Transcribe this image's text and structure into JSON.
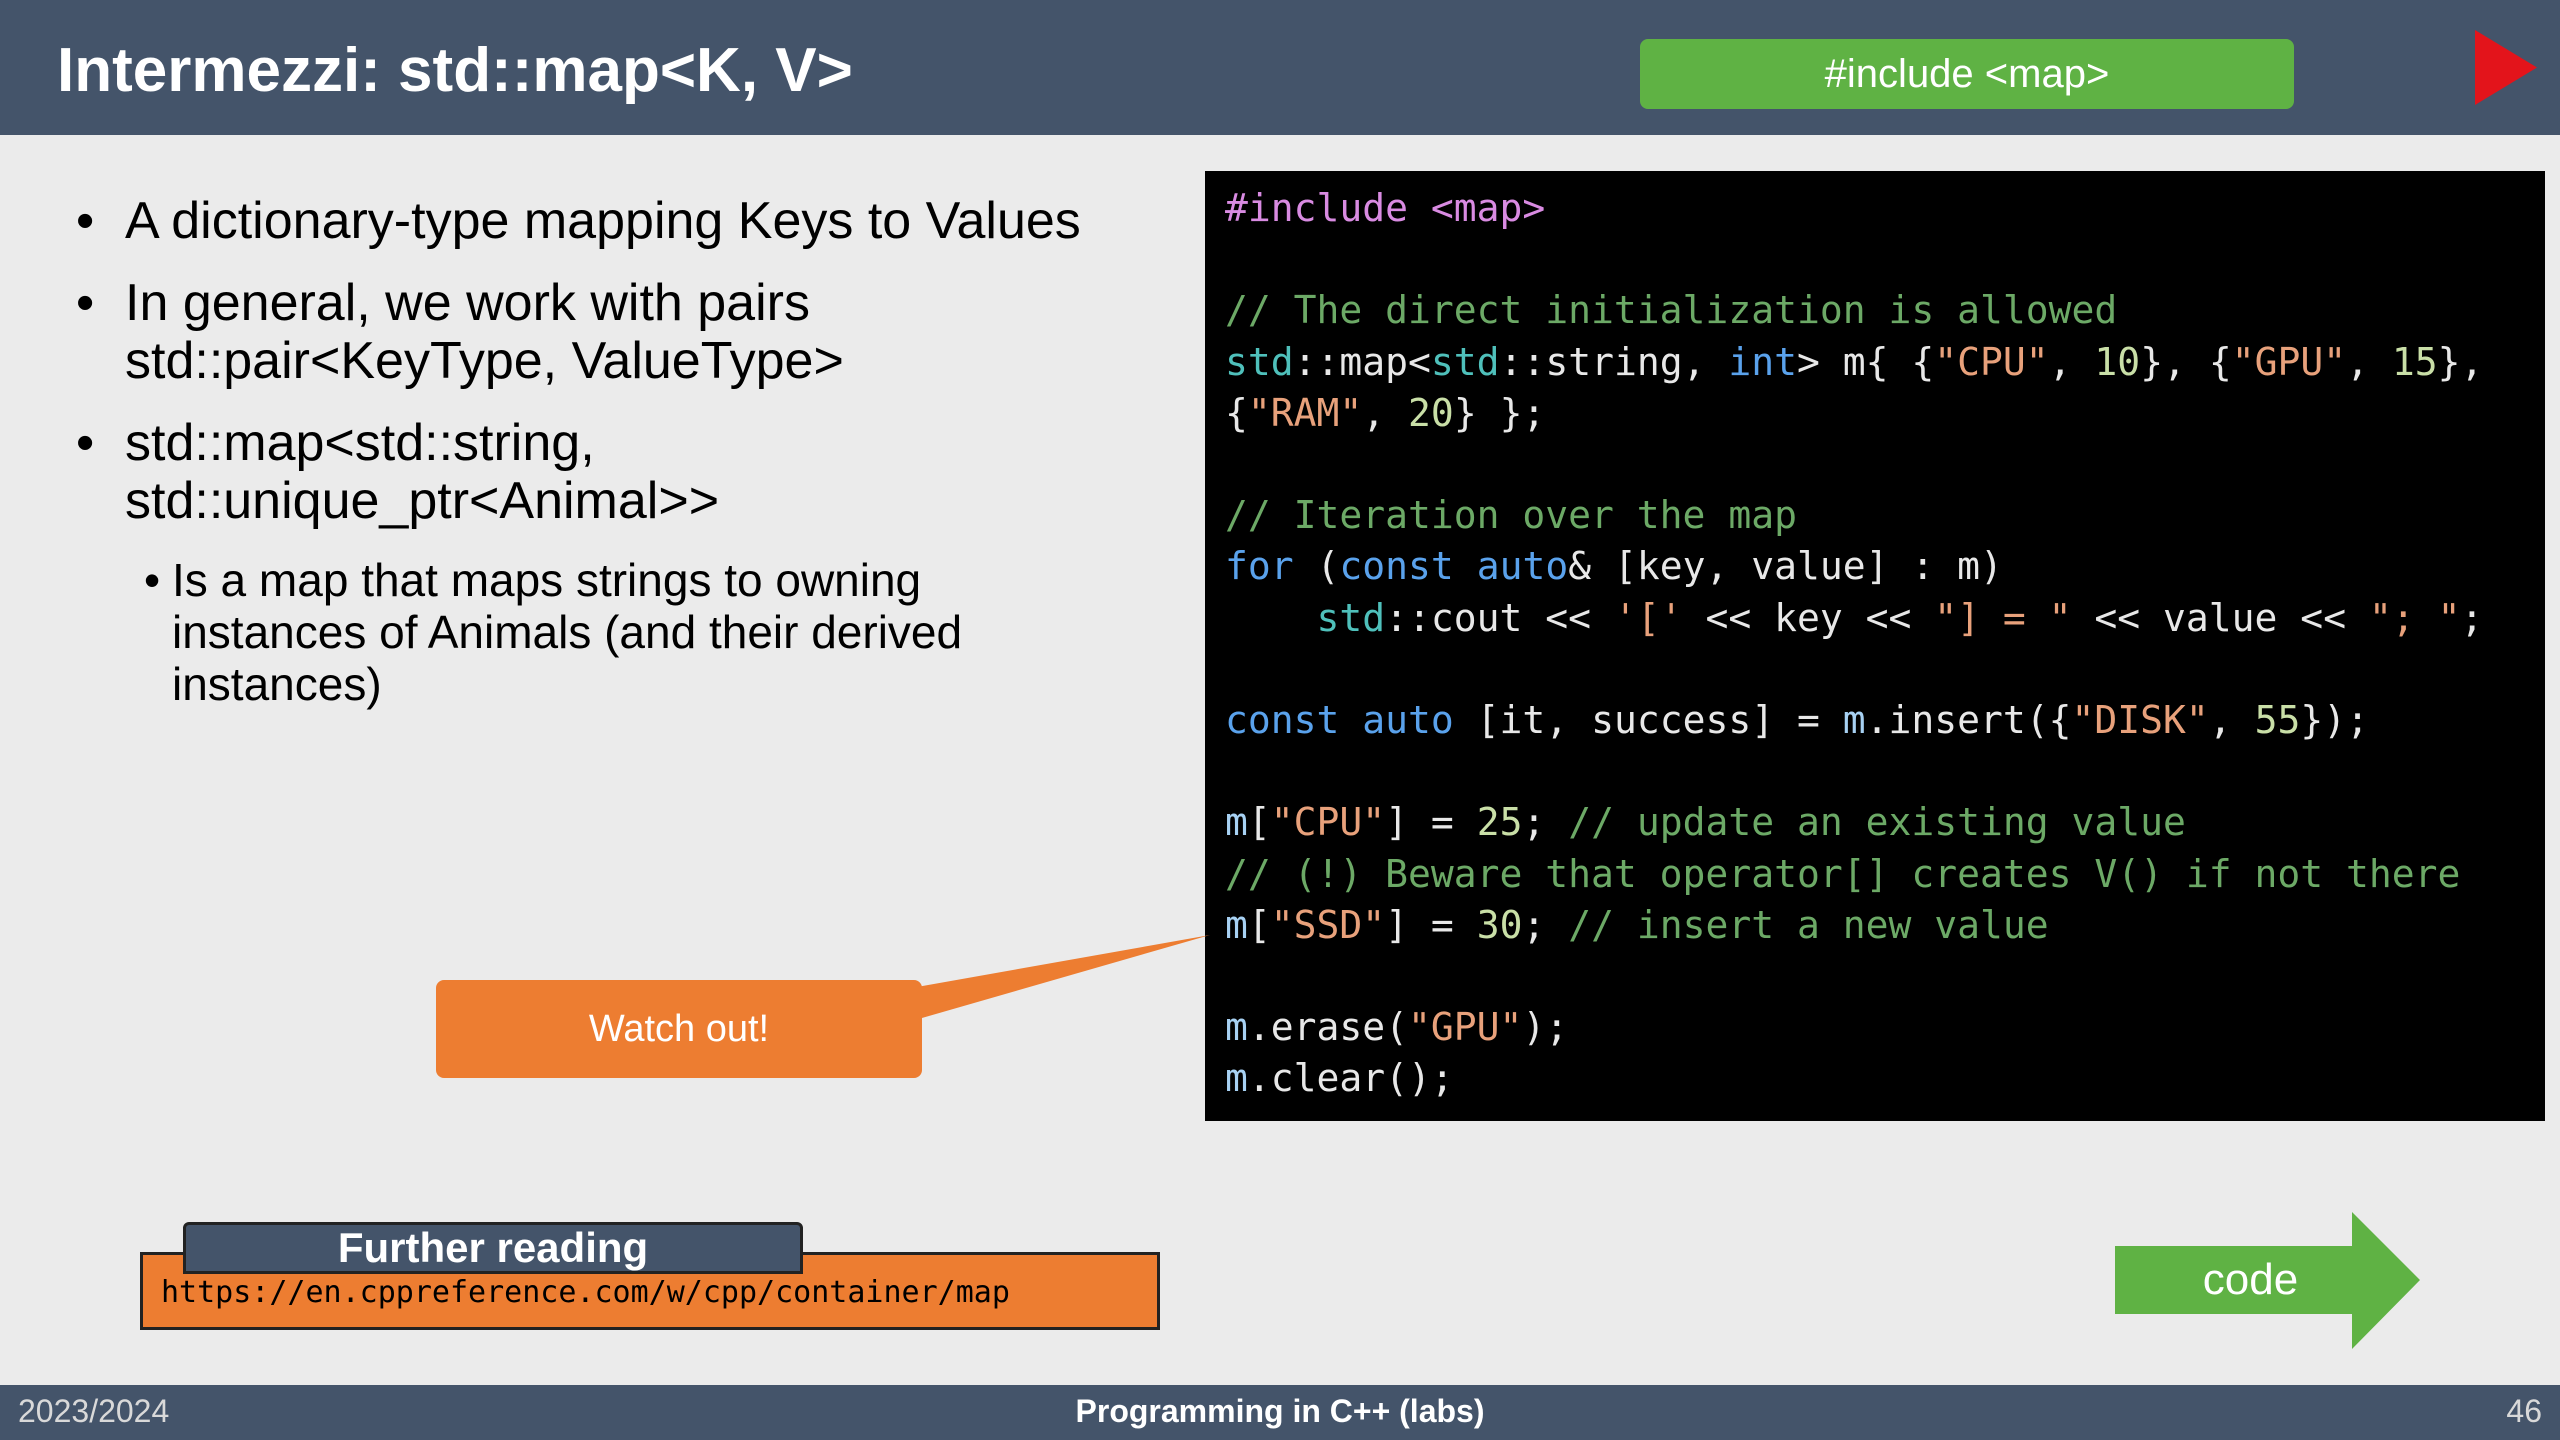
{
  "header": {
    "title": "Intermezzi: std::map<K, V>",
    "include_badge": "#include <map>",
    "next_icon": "play-icon"
  },
  "bullets": {
    "b1": "A dictionary-type mapping Keys to Values",
    "b2_line1": "In general, we work with pairs",
    "b2_line2": "std::pair<KeyType, ValueType>",
    "b3_line1": "std::map<std::string,",
    "b3_line2": "std::unique_ptr<Animal>>",
    "sub_line1": "Is a map that maps strings to owning",
    "sub_line2": "instances of Animals (and their derived",
    "sub_line3": "instances)",
    "dot": "•"
  },
  "code": {
    "l1": {
      "a": "#include <map>"
    },
    "l3": {
      "a": "// The direct initialization is allowed"
    },
    "l4": {
      "a": "std",
      "b": "::map<",
      "c": "std",
      "d": "::string, ",
      "e": "int",
      "f": "> m{ {",
      "g": "\"CPU\"",
      "h": ", ",
      "i": "10",
      "j": "}, {",
      "k": "\"GPU\"",
      "l": ", ",
      "m": "15",
      "n": "},"
    },
    "l5": {
      "a": "{",
      "b": "\"RAM\"",
      "c": ", ",
      "d": "20",
      "e": "} };"
    },
    "l7": {
      "a": "// Iteration over the map"
    },
    "l8": {
      "a": "for",
      "b": " (",
      "c": "const",
      "d": " ",
      "e": "auto",
      "f": "& [key, value] : m)"
    },
    "l9": {
      "a": "    ",
      "b": "std",
      "c": "::cout << ",
      "d": "'['",
      "e": " << key << ",
      "f": "\"] = \"",
      "g": " << value << ",
      "h": "\"; \"",
      "i": ";"
    },
    "l11": {
      "a": "const",
      "b": " ",
      "c": "auto",
      "d": " [it, success] = ",
      "e": "m",
      "f": ".insert({",
      "g": "\"DISK\"",
      "h": ", ",
      "i": "55",
      "j": "});"
    },
    "l13": {
      "a": "m",
      "b": "[",
      "c": "\"CPU\"",
      "d": "] = ",
      "e": "25",
      "f": "; ",
      "g": "// update an existing value"
    },
    "l14": {
      "a": "// (!) Beware that operator[] creates V() if not there"
    },
    "l15": {
      "a": "m",
      "b": "[",
      "c": "\"SSD\"",
      "d": "] = ",
      "e": "30",
      "f": "; ",
      "g": "// insert a new value"
    },
    "l17": {
      "a": "m",
      "b": ".erase(",
      "c": "\"GPU\"",
      "d": ");"
    },
    "l18": {
      "a": "m",
      "b": ".clear();"
    }
  },
  "callout": {
    "text": "Watch out!"
  },
  "further_reading": {
    "label": "Further reading",
    "url": "https://en.cppreference.com/w/cpp/container/map"
  },
  "code_link": {
    "label": "code"
  },
  "footer": {
    "year": "2023/2024",
    "course": "Programming in C++ (labs)",
    "page": "46"
  },
  "colors": {
    "header_bg": "#44546a",
    "badge_green": "#5fb244",
    "accent_red": "#e3141b",
    "callout_orange": "#ed7d31",
    "code_bg": "#000000"
  }
}
